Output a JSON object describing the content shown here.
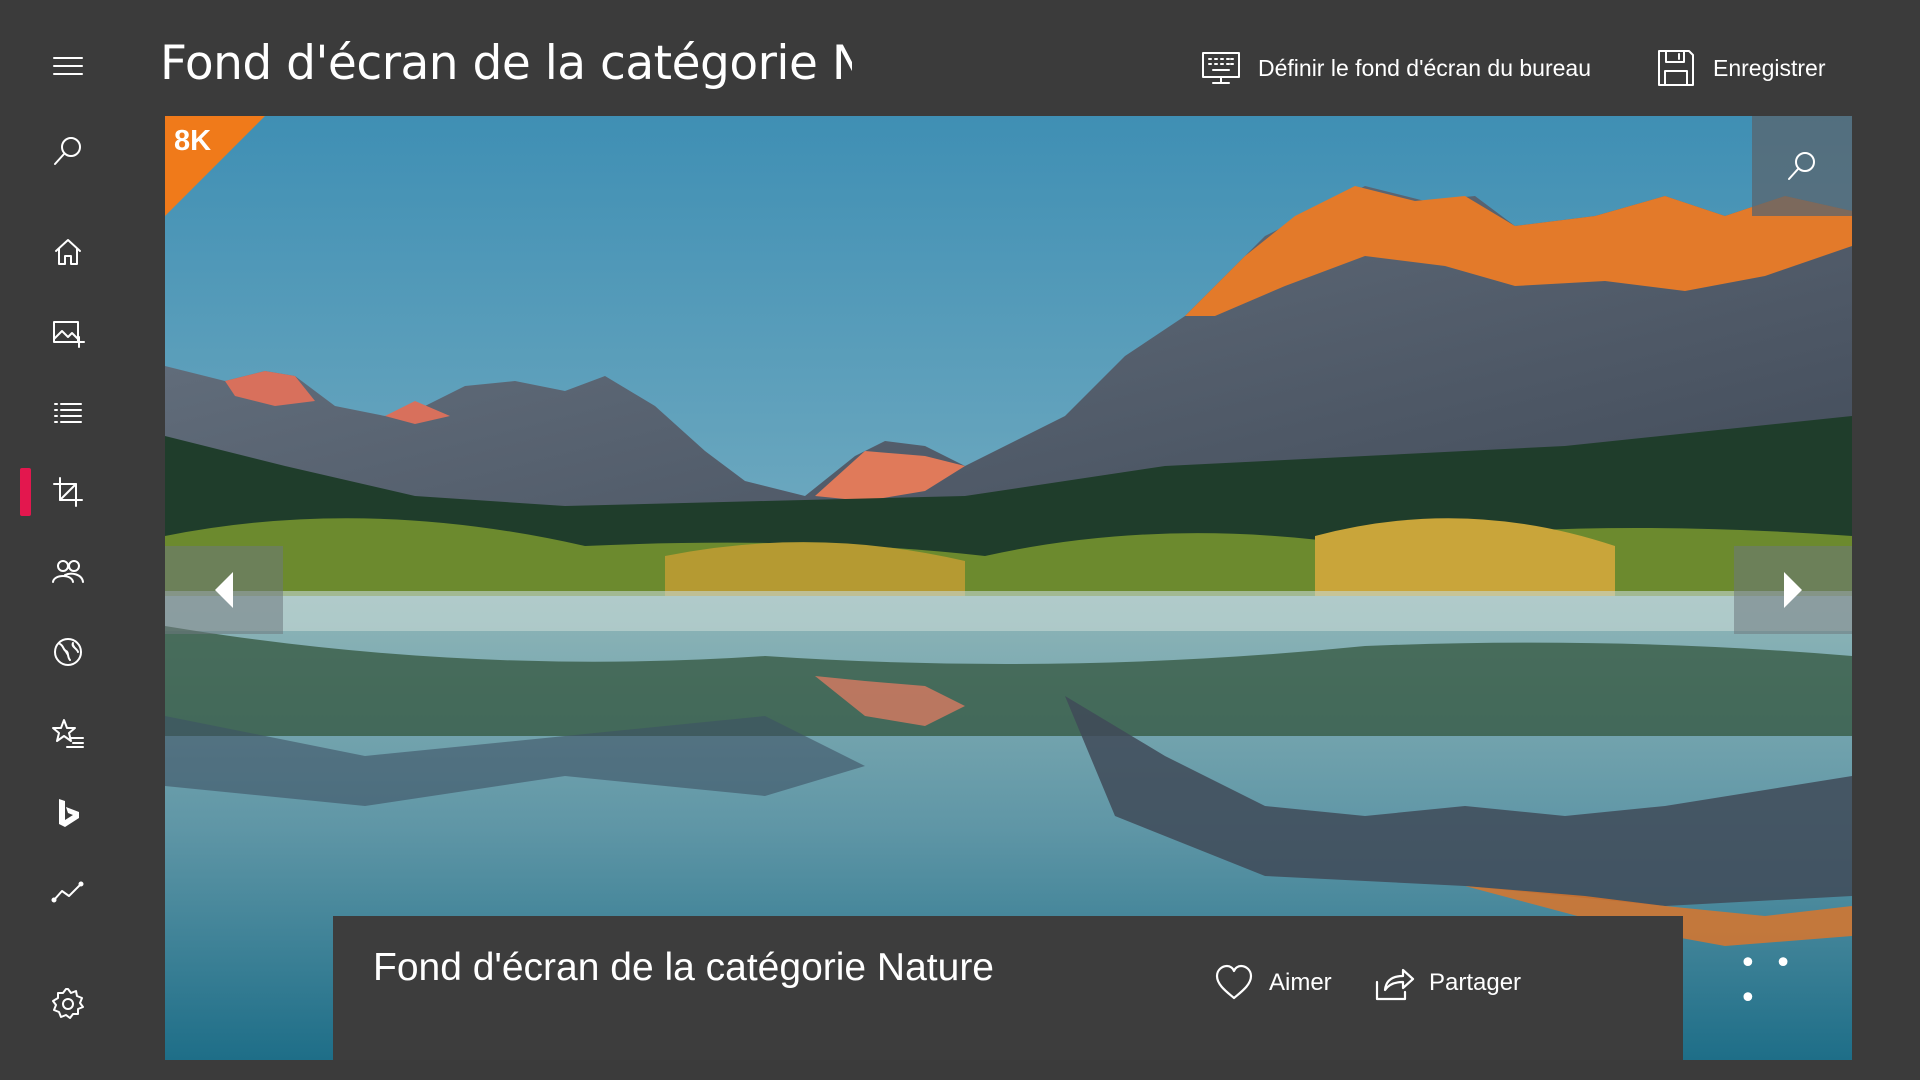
{
  "header": {
    "title": "Fond d'écran de la catégorie Natu",
    "set_wallpaper_label": "Définir le fond d'écran du bureau",
    "save_label": "Enregistrer"
  },
  "sidebar": {
    "items": [
      {
        "icon": "hamburger-menu-icon"
      },
      {
        "icon": "search-icon"
      },
      {
        "icon": "home-icon"
      },
      {
        "icon": "add-image-icon"
      },
      {
        "icon": "list-icon"
      },
      {
        "icon": "crop-icon",
        "active": true
      },
      {
        "icon": "people-icon"
      },
      {
        "icon": "globe-icon"
      },
      {
        "icon": "star-list-icon"
      },
      {
        "icon": "bing-icon"
      },
      {
        "icon": "trend-icon"
      },
      {
        "icon": "gear-icon"
      }
    ],
    "active_color": "#e3174e"
  },
  "image": {
    "badge": "8K",
    "badge_color": "#f07a1a"
  },
  "info_bar": {
    "title": "Fond d'écran de la catégorie Nature",
    "like_label": "Aimer",
    "share_label": "Partager",
    "more_label": "• • •"
  }
}
